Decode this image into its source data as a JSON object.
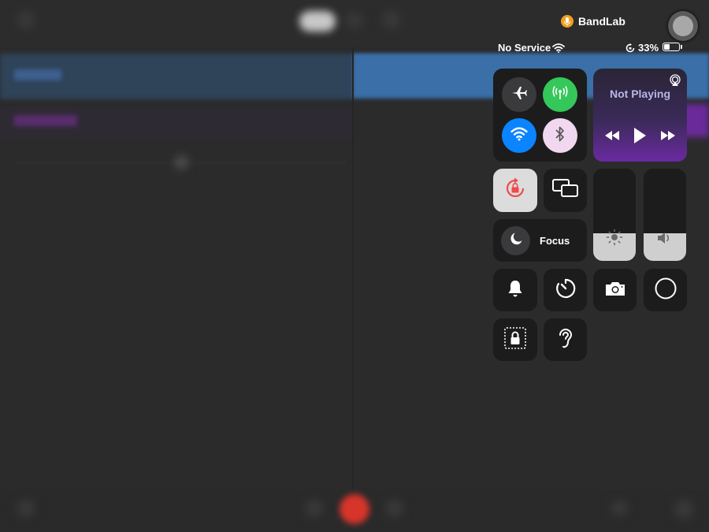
{
  "status_bar": {
    "carrier": "No Service",
    "battery_percent": "33%",
    "battery_level": 0.33,
    "active_app": "BandLab"
  },
  "media": {
    "title": "Not Playing"
  },
  "focus": {
    "label": "Focus"
  },
  "brightness_level": 0.3,
  "volume_level": 0.3,
  "colors": {
    "cellular_green": "#34c759",
    "wifi_blue": "#0a84ff",
    "bluetooth_bg": "#f1d7ef",
    "rotation_lock_red": "#f04a4a",
    "recording_mic": "#f0a020"
  },
  "icons": [
    "airplane-icon",
    "cellular-icon",
    "wifi-icon",
    "bluetooth-icon",
    "airplay-icon",
    "rewind-icon",
    "play-icon",
    "fast-forward-icon",
    "rotation-lock-icon",
    "screen-mirroring-icon",
    "moon-icon",
    "brightness-icon",
    "volume-icon",
    "bell-icon",
    "timer-icon",
    "camera-icon",
    "screen-record-icon",
    "guided-access-icon",
    "hearing-icon",
    "mic-icon"
  ]
}
